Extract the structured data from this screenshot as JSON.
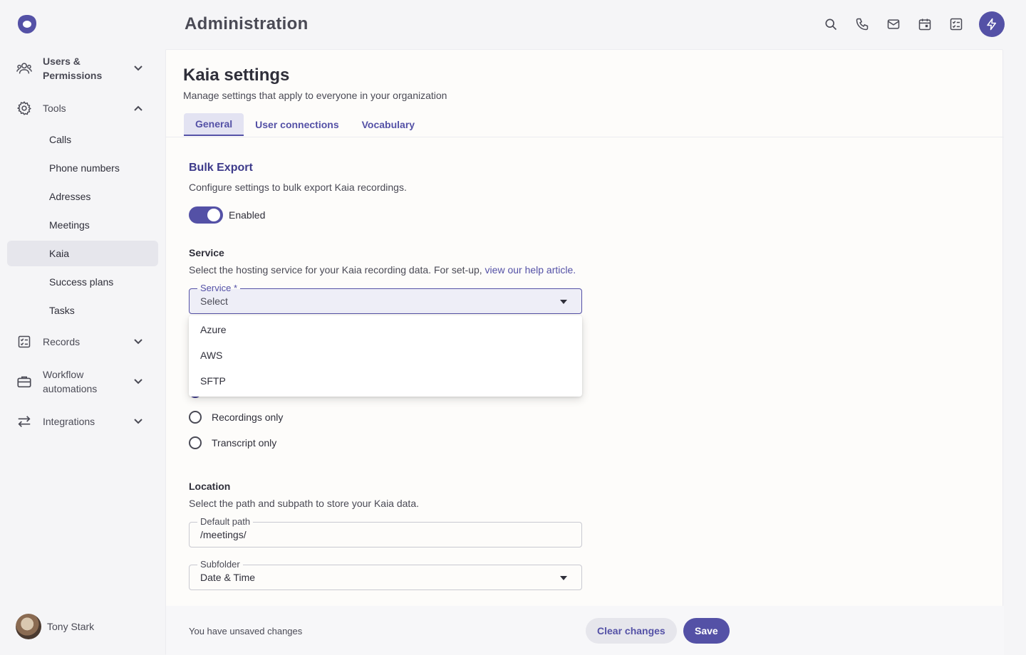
{
  "header": {
    "title": "Administration"
  },
  "sidebar": {
    "groups": [
      {
        "label": "Users & Permissions",
        "icon": "users-icon"
      },
      {
        "label": "Tools",
        "icon": "gear-icon"
      },
      {
        "label": "Records",
        "icon": "checklist-icon"
      },
      {
        "label": "Workflow automations",
        "icon": "briefcase-icon"
      },
      {
        "label": "Integrations",
        "icon": "arrows-swap-icon"
      }
    ],
    "tool_items": [
      "Calls",
      "Phone numbers",
      "Adresses",
      "Meetings",
      "Kaia",
      "Success plans",
      "Tasks"
    ],
    "active_item": "Kaia",
    "user": {
      "name": "Tony Stark"
    }
  },
  "top_icons": [
    "search-icon",
    "phone-icon",
    "mail-icon",
    "calendar-icon",
    "checklist-icon",
    "bolt-icon"
  ],
  "panel": {
    "title": "Kaia settings",
    "subtitle": "Manage settings that apply to everyone in your organization",
    "tabs": [
      "General",
      "User connections",
      "Vocabulary"
    ],
    "active_tab": "General"
  },
  "bulk_export": {
    "title": "Bulk Export",
    "description": "Configure settings to bulk export Kaia recordings.",
    "toggle_label": "Enabled",
    "enabled": true
  },
  "service": {
    "heading": "Service",
    "description": "Select the hosting service for your Kaia recording data. For set-up, ",
    "link_text": "view our help article.",
    "field_label": "Service *",
    "field_value": "Select",
    "options": [
      "Azure",
      "AWS",
      "SFTP"
    ]
  },
  "export_options": [
    "Recordings only",
    "Transcript only"
  ],
  "location": {
    "heading": "Location",
    "description": "Select the path and subpath to store your Kaia data.",
    "path_label": "Default path",
    "path_value": "/meetings/",
    "subfolder_label": "Subfolder",
    "subfolder_value": "Date & Time"
  },
  "footer": {
    "unsaved_text": "You have unsaved changes",
    "clear_label": "Clear changes",
    "save_label": "Save"
  },
  "colors": {
    "accent": "#5451a6",
    "accent_dark": "#3d3a8a",
    "active_bg": "#e6e6ec"
  }
}
